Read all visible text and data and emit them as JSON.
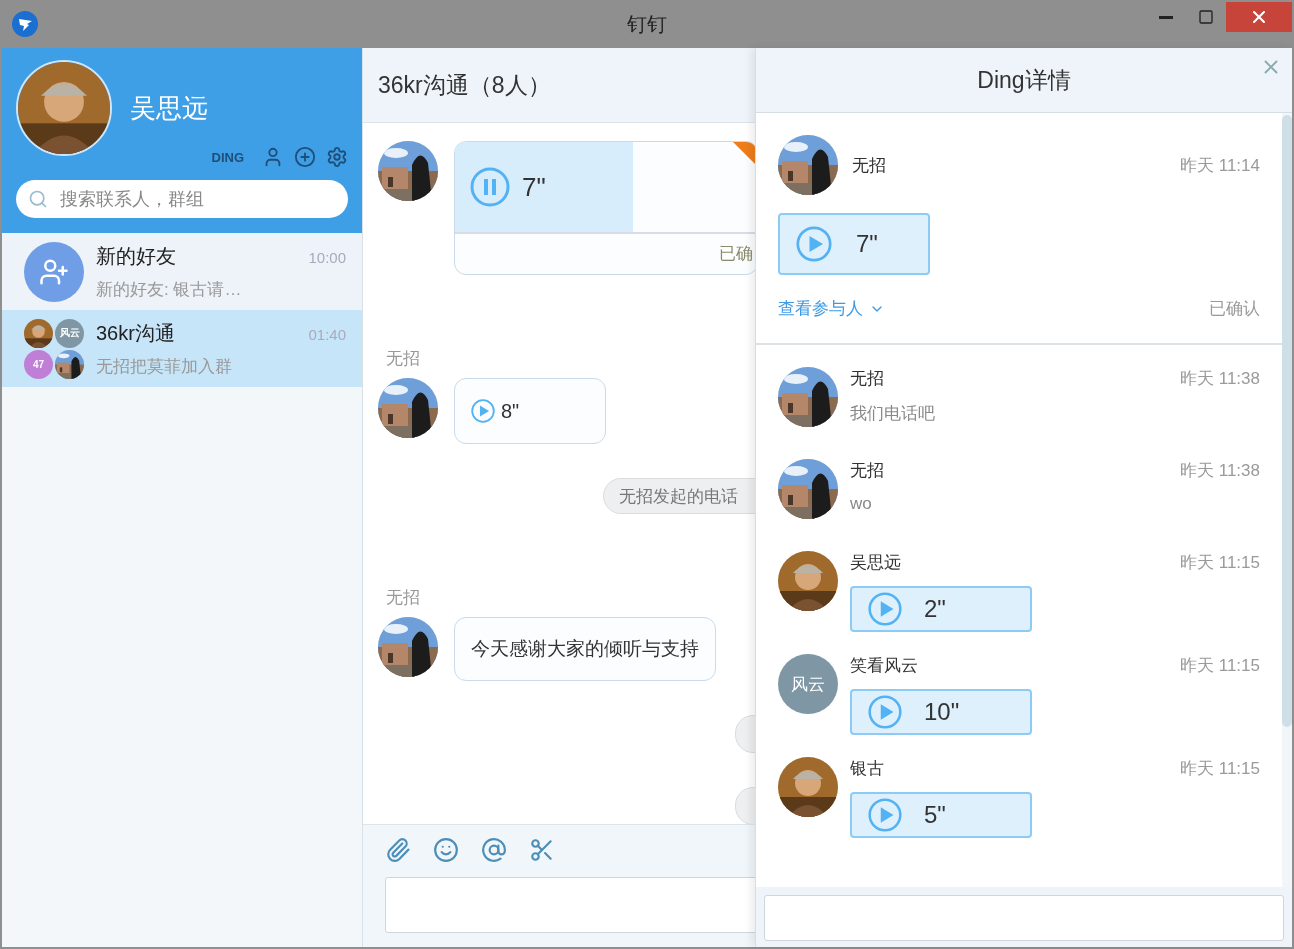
{
  "window": {
    "title": "钉钉"
  },
  "profile": {
    "name": "吴思远",
    "ding_label": "DING",
    "avatar": {
      "kind": "picture"
    }
  },
  "search": {
    "placeholder": "搜索联系人，群组"
  },
  "conversations": [
    {
      "avatar": {
        "kind": "add_friend"
      },
      "name": "新的好友",
      "time": "10:00",
      "preview": "新的好友: 银古请…",
      "selected": false
    },
    {
      "avatar": {
        "kind": "group",
        "tiles": [
          {
            "kind": "picture"
          },
          {
            "kind": "initials",
            "text": "风云",
            "color": "#7f97a5"
          },
          {
            "kind": "initials",
            "text": "47",
            "color": "#c07fd6"
          },
          {
            "kind": "picture"
          }
        ]
      },
      "name": "36kr沟通",
      "time": "01:40",
      "preview": "无招把莫菲加入群",
      "selected": true
    }
  ],
  "chat": {
    "title": "36kr沟通（8人）",
    "messages": [
      {
        "kind": "ding_voice",
        "duration": "7\"",
        "playing": true,
        "level": 0.59,
        "status": "已确"
      },
      {
        "kind": "voice",
        "sender": "无招",
        "duration": "8\""
      },
      {
        "kind": "system",
        "text": "无招发起的电话"
      },
      {
        "kind": "text",
        "sender": "无招",
        "text": "今天感谢大家的倾听与支持"
      },
      {
        "kind": "system_stub"
      },
      {
        "kind": "system_stub"
      }
    ]
  },
  "ding": {
    "title": "Ding详情",
    "sender": "无招",
    "time": "昨天 11:14",
    "duration": "7\"",
    "participants_link": "查看参与人",
    "status": "已确认",
    "replies": [
      {
        "name": "无招",
        "time": "昨天 11:38",
        "avatar": {
          "kind": "picture"
        },
        "kind": "text",
        "text": "我们电话吧"
      },
      {
        "name": "无招",
        "time": "昨天 11:38",
        "avatar": {
          "kind": "picture"
        },
        "kind": "text",
        "text": "wo"
      },
      {
        "name": "吴思远",
        "time": "昨天 11:15",
        "avatar": {
          "kind": "picture"
        },
        "kind": "voice",
        "duration": "2\""
      },
      {
        "name": "笑看风云",
        "time": "昨天 11:15",
        "avatar": {
          "kind": "initials",
          "text": "风云",
          "color": "#7f97a5"
        },
        "kind": "voice",
        "duration": "10\""
      },
      {
        "name": "银古",
        "time": "昨天 11:15",
        "avatar": {
          "kind": "picture"
        },
        "kind": "voice",
        "duration": "5\""
      }
    ]
  }
}
